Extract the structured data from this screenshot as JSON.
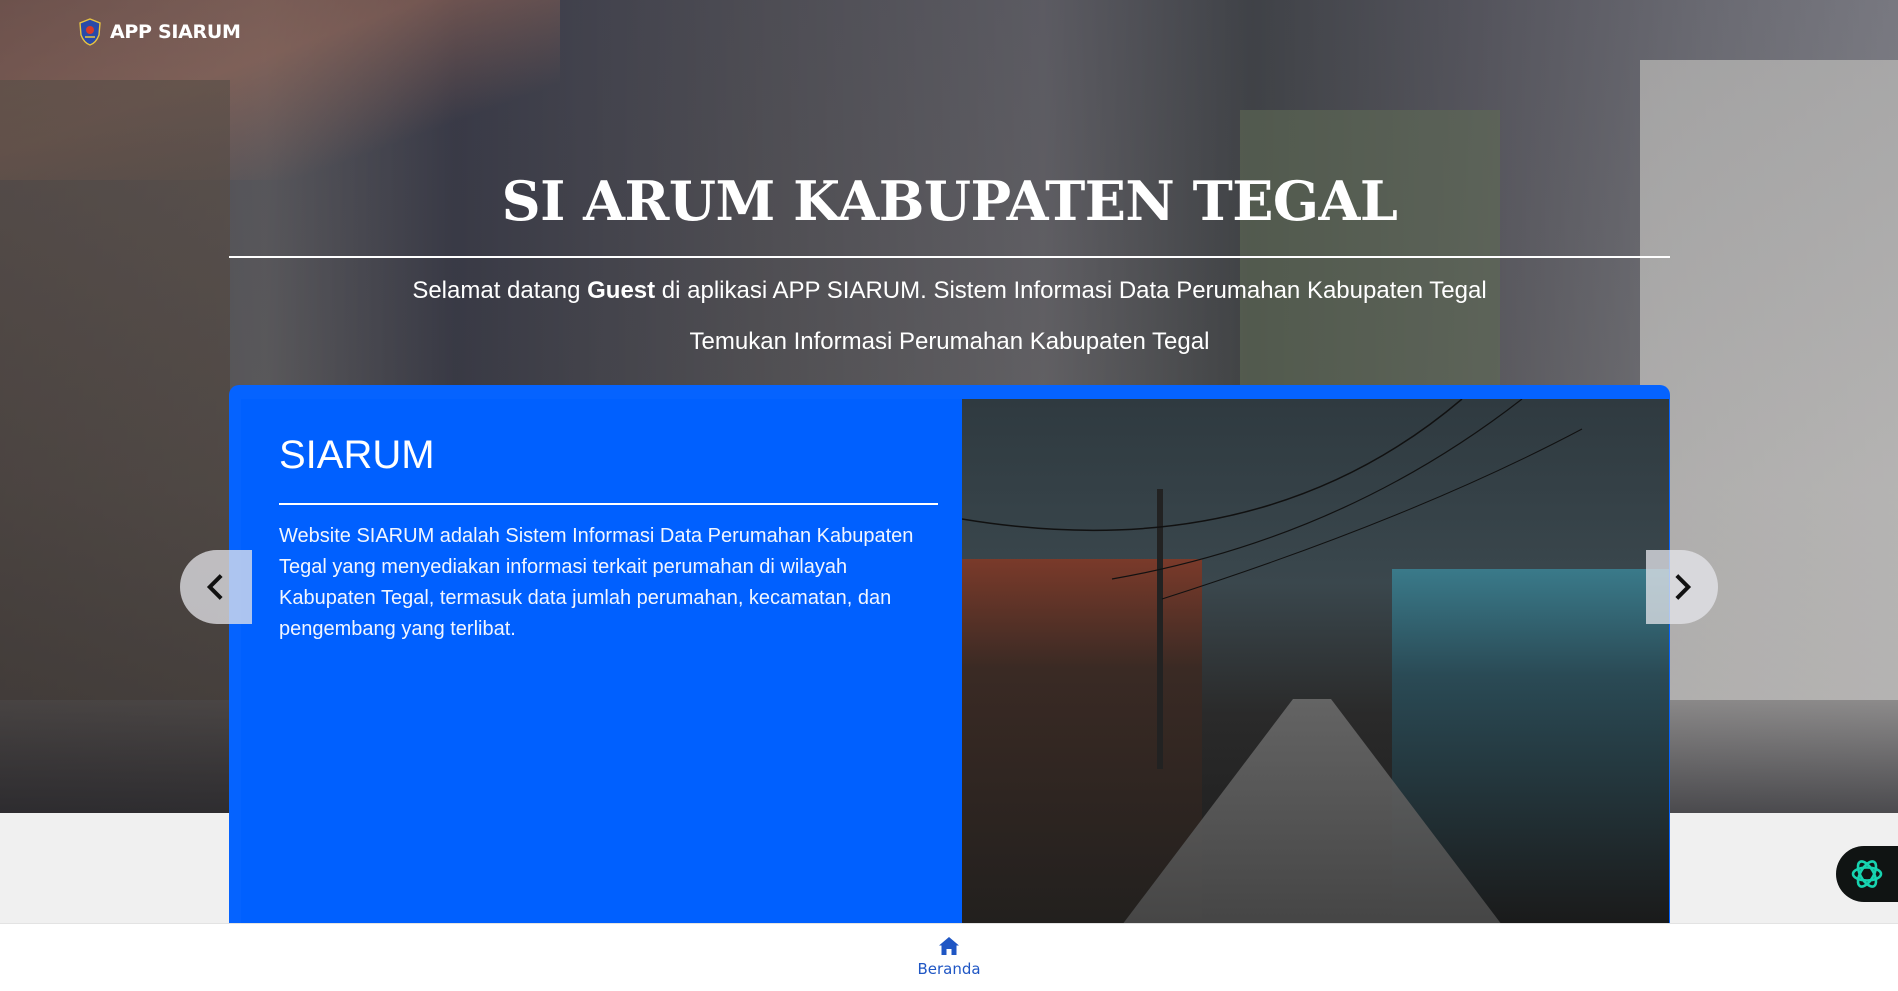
{
  "navbar": {
    "brand": "APP SIARUM",
    "logo_icon": "kabupaten-tegal-crest-icon"
  },
  "hero": {
    "title": "SI ARUM KABUPATEN TEGAL",
    "welcome_prefix": "Selamat datang ",
    "welcome_user": "Guest",
    "welcome_suffix": " di aplikasi APP SIARUM. Sistem Informasi Data Perumahan Kabupaten Tegal",
    "tagline": "Temukan Informasi Perumahan Kabupaten Tegal"
  },
  "carousel": {
    "slide": {
      "heading": "SIARUM",
      "body": "Website SIARUM adalah Sistem Informasi Data Perumahan Kabupaten Tegal yang menyediakan informasi terkait perumahan di wilayah Kabupaten Tegal, termasuk data jumlah perumahan, kecamatan, dan pengembang yang terlibat."
    },
    "prev_icon": "chevron-left-icon",
    "next_icon": "chevron-right-icon"
  },
  "bottom_nav": {
    "items": [
      {
        "label": "Beranda",
        "icon": "home-icon"
      }
    ]
  },
  "colors": {
    "card_blue": "#0060ff",
    "nav_blue": "#1f56c4",
    "chat_fab": "#101413",
    "chat_icon": "#17d4b0"
  }
}
